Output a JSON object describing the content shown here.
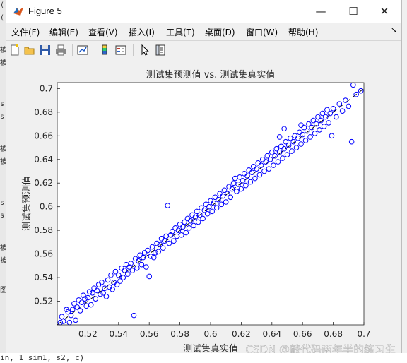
{
  "window": {
    "title": "Figure 5",
    "controls": {
      "minimize": "—",
      "maximize": "☐",
      "close": "✕"
    }
  },
  "menu": {
    "items": [
      "文件(F)",
      "编辑(E)",
      "查看(V)",
      "插入(I)",
      "工具(T)",
      "桌面(D)",
      "窗口(W)",
      "帮助(H)"
    ],
    "dock_glyph": "↘"
  },
  "toolbar": {
    "icons": [
      "new-figure-icon",
      "open-file-icon",
      "save-icon",
      "print-icon",
      "link-plot-icon",
      "insert-colorbar-icon",
      "insert-legend-icon",
      "edit-plot-arrow-icon",
      "property-inspector-icon"
    ]
  },
  "background_text": {
    "left_fragments": [
      "(",
      "(",
      "被",
      "被",
      "s",
      "s",
      "被",
      "被",
      "s",
      "s",
      "被",
      "被",
      "图"
    ],
    "bottom_code": "in, 1_sim1, s2, c)"
  },
  "watermark": "CSDN @敲代码两年半的练习生",
  "chart_data": {
    "type": "scatter",
    "title": "测试集预测值 vs. 测试集真实值",
    "xlabel": "测试集真实值",
    "ylabel": "测试集预测值",
    "xlim": [
      0.5,
      0.7
    ],
    "ylim": [
      0.5,
      0.705
    ],
    "xticks": [
      "0.52",
      "0.54",
      "0.56",
      "0.58",
      "0.6",
      "0.62",
      "0.64",
      "0.66",
      "0.68",
      "0.7"
    ],
    "yticks": [
      "0.52",
      "0.54",
      "0.56",
      "0.58",
      "0.6",
      "0.62",
      "0.64",
      "0.66",
      "0.68",
      "0.7"
    ],
    "grid": false,
    "marker_color": "#0000ff",
    "reference_line": {
      "style": "dashed",
      "color": "#000000",
      "from": [
        0.5,
        0.5
      ],
      "to": [
        0.7,
        0.7
      ]
    },
    "points": [
      [
        0.502,
        0.502
      ],
      [
        0.503,
        0.507
      ],
      [
        0.504,
        0.503
      ],
      [
        0.506,
        0.513
      ],
      [
        0.507,
        0.511
      ],
      [
        0.508,
        0.502
      ],
      [
        0.509,
        0.508
      ],
      [
        0.51,
        0.513
      ],
      [
        0.511,
        0.518
      ],
      [
        0.512,
        0.504
      ],
      [
        0.513,
        0.515
      ],
      [
        0.514,
        0.521
      ],
      [
        0.515,
        0.512
      ],
      [
        0.516,
        0.519
      ],
      [
        0.517,
        0.525
      ],
      [
        0.518,
        0.522
      ],
      [
        0.519,
        0.516
      ],
      [
        0.52,
        0.523
      ],
      [
        0.521,
        0.528
      ],
      [
        0.522,
        0.517
      ],
      [
        0.523,
        0.527
      ],
      [
        0.524,
        0.531
      ],
      [
        0.525,
        0.522
      ],
      [
        0.526,
        0.529
      ],
      [
        0.527,
        0.534
      ],
      [
        0.528,
        0.526
      ],
      [
        0.529,
        0.536
      ],
      [
        0.53,
        0.527
      ],
      [
        0.531,
        0.531
      ],
      [
        0.532,
        0.524
      ],
      [
        0.533,
        0.538
      ],
      [
        0.534,
        0.532
      ],
      [
        0.535,
        0.542
      ],
      [
        0.536,
        0.53
      ],
      [
        0.537,
        0.536
      ],
      [
        0.538,
        0.545
      ],
      [
        0.539,
        0.534
      ],
      [
        0.54,
        0.542
      ],
      [
        0.541,
        0.537
      ],
      [
        0.542,
        0.548
      ],
      [
        0.543,
        0.54
      ],
      [
        0.544,
        0.546
      ],
      [
        0.545,
        0.551
      ],
      [
        0.546,
        0.543
      ],
      [
        0.547,
        0.549
      ],
      [
        0.548,
        0.552
      ],
      [
        0.549,
        0.546
      ],
      [
        0.55,
        0.508
      ],
      [
        0.551,
        0.556
      ],
      [
        0.552,
        0.548
      ],
      [
        0.553,
        0.554
      ],
      [
        0.554,
        0.559
      ],
      [
        0.555,
        0.551
      ],
      [
        0.556,
        0.557
      ],
      [
        0.557,
        0.561
      ],
      [
        0.558,
        0.549
      ],
      [
        0.559,
        0.563
      ],
      [
        0.56,
        0.541
      ],
      [
        0.561,
        0.558
      ],
      [
        0.562,
        0.566
      ],
      [
        0.563,
        0.557
      ],
      [
        0.564,
        0.561
      ],
      [
        0.565,
        0.569
      ],
      [
        0.566,
        0.562
      ],
      [
        0.567,
        0.568
      ],
      [
        0.568,
        0.573
      ],
      [
        0.569,
        0.565
      ],
      [
        0.57,
        0.571
      ],
      [
        0.571,
        0.575
      ],
      [
        0.572,
        0.601
      ],
      [
        0.573,
        0.569
      ],
      [
        0.574,
        0.576
      ],
      [
        0.575,
        0.579
      ],
      [
        0.576,
        0.571
      ],
      [
        0.577,
        0.582
      ],
      [
        0.578,
        0.575
      ],
      [
        0.579,
        0.58
      ],
      [
        0.58,
        0.585
      ],
      [
        0.581,
        0.576
      ],
      [
        0.582,
        0.583
      ],
      [
        0.583,
        0.587
      ],
      [
        0.584,
        0.578
      ],
      [
        0.585,
        0.59
      ],
      [
        0.586,
        0.582
      ],
      [
        0.587,
        0.588
      ],
      [
        0.588,
        0.593
      ],
      [
        0.589,
        0.584
      ],
      [
        0.59,
        0.591
      ],
      [
        0.591,
        0.596
      ],
      [
        0.592,
        0.587
      ],
      [
        0.593,
        0.593
      ],
      [
        0.594,
        0.599
      ],
      [
        0.595,
        0.59
      ],
      [
        0.596,
        0.597
      ],
      [
        0.597,
        0.602
      ],
      [
        0.598,
        0.594
      ],
      [
        0.599,
        0.6
      ],
      [
        0.6,
        0.605
      ],
      [
        0.601,
        0.596
      ],
      [
        0.602,
        0.603
      ],
      [
        0.603,
        0.608
      ],
      [
        0.604,
        0.599
      ],
      [
        0.605,
        0.606
      ],
      [
        0.606,
        0.611
      ],
      [
        0.607,
        0.602
      ],
      [
        0.608,
        0.609
      ],
      [
        0.609,
        0.614
      ],
      [
        0.61,
        0.604
      ],
      [
        0.611,
        0.611
      ],
      [
        0.612,
        0.617
      ],
      [
        0.613,
        0.608
      ],
      [
        0.614,
        0.615
      ],
      [
        0.615,
        0.62
      ],
      [
        0.616,
        0.624
      ],
      [
        0.617,
        0.613
      ],
      [
        0.618,
        0.619
      ],
      [
        0.619,
        0.625
      ],
      [
        0.62,
        0.615
      ],
      [
        0.621,
        0.622
      ],
      [
        0.622,
        0.628
      ],
      [
        0.623,
        0.618
      ],
      [
        0.624,
        0.626
      ],
      [
        0.625,
        0.631
      ],
      [
        0.626,
        0.621
      ],
      [
        0.627,
        0.629
      ],
      [
        0.628,
        0.634
      ],
      [
        0.629,
        0.624
      ],
      [
        0.63,
        0.632
      ],
      [
        0.631,
        0.637
      ],
      [
        0.632,
        0.627
      ],
      [
        0.633,
        0.635
      ],
      [
        0.634,
        0.64
      ],
      [
        0.635,
        0.63
      ],
      [
        0.636,
        0.638
      ],
      [
        0.637,
        0.643
      ],
      [
        0.638,
        0.632
      ],
      [
        0.639,
        0.64
      ],
      [
        0.64,
        0.646
      ],
      [
        0.641,
        0.635
      ],
      [
        0.642,
        0.643
      ],
      [
        0.643,
        0.649
      ],
      [
        0.644,
        0.638
      ],
      [
        0.645,
        0.646
      ],
      [
        0.646,
        0.651
      ],
      [
        0.647,
        0.641
      ],
      [
        0.648,
        0.649
      ],
      [
        0.649,
        0.655
      ],
      [
        0.65,
        0.644
      ],
      [
        0.651,
        0.652
      ],
      [
        0.652,
        0.658
      ],
      [
        0.653,
        0.647
      ],
      [
        0.654,
        0.655
      ],
      [
        0.655,
        0.66
      ],
      [
        0.656,
        0.65
      ],
      [
        0.657,
        0.658
      ],
      [
        0.658,
        0.663
      ],
      [
        0.659,
        0.653
      ],
      [
        0.66,
        0.661
      ],
      [
        0.661,
        0.667
      ],
      [
        0.662,
        0.656
      ],
      [
        0.663,
        0.664
      ],
      [
        0.664,
        0.67
      ],
      [
        0.665,
        0.659
      ],
      [
        0.666,
        0.667
      ],
      [
        0.667,
        0.673
      ],
      [
        0.668,
        0.662
      ],
      [
        0.669,
        0.67
      ],
      [
        0.67,
        0.676
      ],
      [
        0.671,
        0.665
      ],
      [
        0.672,
        0.673
      ],
      [
        0.673,
        0.679
      ],
      [
        0.674,
        0.668
      ],
      [
        0.675,
        0.676
      ],
      [
        0.676,
        0.682
      ],
      [
        0.677,
        0.671
      ],
      [
        0.678,
        0.679
      ],
      [
        0.679,
        0.66
      ],
      [
        0.68,
        0.683
      ],
      [
        0.682,
        0.676
      ],
      [
        0.684,
        0.687
      ],
      [
        0.686,
        0.681
      ],
      [
        0.688,
        0.69
      ],
      [
        0.69,
        0.685
      ],
      [
        0.692,
        0.655
      ],
      [
        0.693,
        0.703
      ],
      [
        0.695,
        0.695
      ],
      [
        0.698,
        0.698
      ],
      [
        0.645,
        0.659
      ],
      [
        0.648,
        0.666
      ],
      [
        0.659,
        0.669
      ]
    ]
  }
}
